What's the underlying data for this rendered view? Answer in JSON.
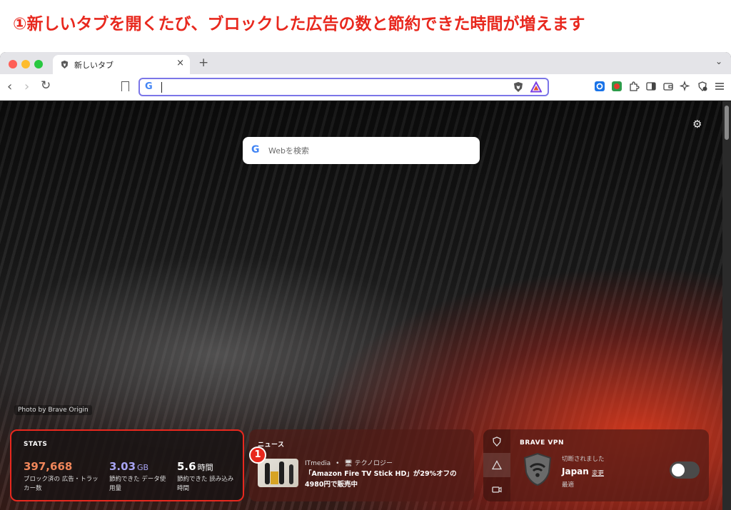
{
  "caption": "①新しいタブを開くたび、ブロックした広告の数と節約できた時間が増えます",
  "tab": {
    "title": "新しいタブ",
    "close": "×",
    "new_tab": "+",
    "menu": "⌄"
  },
  "toolbar": {
    "back": "‹",
    "forward": "›",
    "reload": "↻",
    "google_letter": "G"
  },
  "page": {
    "settings_icon": "⚙",
    "search": {
      "google_letter": "G",
      "placeholder": "Webを検索"
    },
    "photo_credit": "Photo by Brave Origin"
  },
  "stats": {
    "title": "STATS",
    "items": [
      {
        "value": "397,668",
        "unit": "",
        "label": "ブロック済の 広告・トラッカー数",
        "color": "#f0865a"
      },
      {
        "value": "3.03",
        "unit": "GB",
        "label": "節約できた データ使用量",
        "color": "#a7a3f2"
      },
      {
        "value": "5.6",
        "unit": "時間",
        "label": "節約できた 読み込み時間",
        "color": "#ffffff"
      }
    ]
  },
  "news": {
    "title": "ニュース",
    "badge": "1",
    "source": "ITmedia",
    "separator": "•",
    "category": "テクノロジー",
    "headline": "「Amazon Fire TV Stick HD」が29%オフの4980円で販売中"
  },
  "vpn": {
    "title": "BRAVE VPN",
    "status": "切断されました",
    "country": "Japan",
    "change": "変更",
    "server": "最適"
  },
  "colors": {
    "accent_red": "#e8281e",
    "url_border": "#7b76e8"
  }
}
